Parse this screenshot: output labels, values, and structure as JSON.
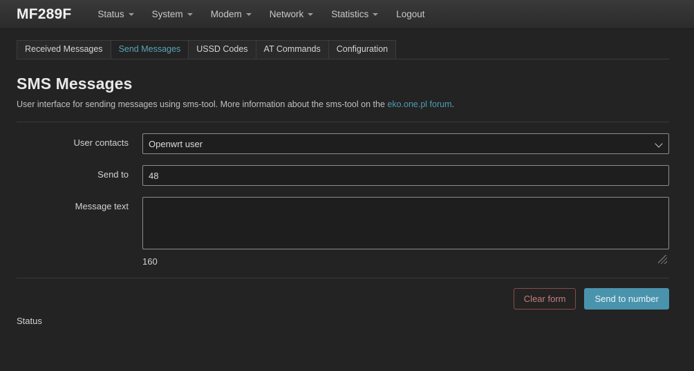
{
  "header": {
    "brand": "MF289F",
    "nav": [
      {
        "label": "Status",
        "has_caret": true
      },
      {
        "label": "System",
        "has_caret": true
      },
      {
        "label": "Modem",
        "has_caret": true
      },
      {
        "label": "Network",
        "has_caret": true
      },
      {
        "label": "Statistics",
        "has_caret": true
      },
      {
        "label": "Logout",
        "has_caret": false
      }
    ]
  },
  "tabs": [
    {
      "label": "Received Messages",
      "active": false
    },
    {
      "label": "Send Messages",
      "active": true
    },
    {
      "label": "USSD Codes",
      "active": false
    },
    {
      "label": "AT Commands",
      "active": false
    },
    {
      "label": "Configuration",
      "active": false
    }
  ],
  "page": {
    "title": "SMS Messages",
    "description_before": "User interface for sending messages using sms-tool. More information about the sms-tool on the ",
    "link_text": "eko.one.pl forum",
    "description_after": "."
  },
  "form": {
    "user_contacts": {
      "label": "User contacts",
      "value": "Openwrt user",
      "options": [
        "Openwrt user"
      ]
    },
    "send_to": {
      "label": "Send to",
      "value": "48",
      "placeholder": ""
    },
    "message_text": {
      "label": "Message text",
      "value": "",
      "placeholder": ""
    },
    "char_count": "160"
  },
  "footer": {
    "clear_button": "Clear form",
    "send_button": "Send to number",
    "status_label": "Status"
  },
  "colors": {
    "page_bg": "#232323",
    "accent_teal": "#4a93ad",
    "link_teal": "#4f9cb3",
    "danger_red": "#8c4a4a",
    "text_primary": "#e8e8e8"
  }
}
